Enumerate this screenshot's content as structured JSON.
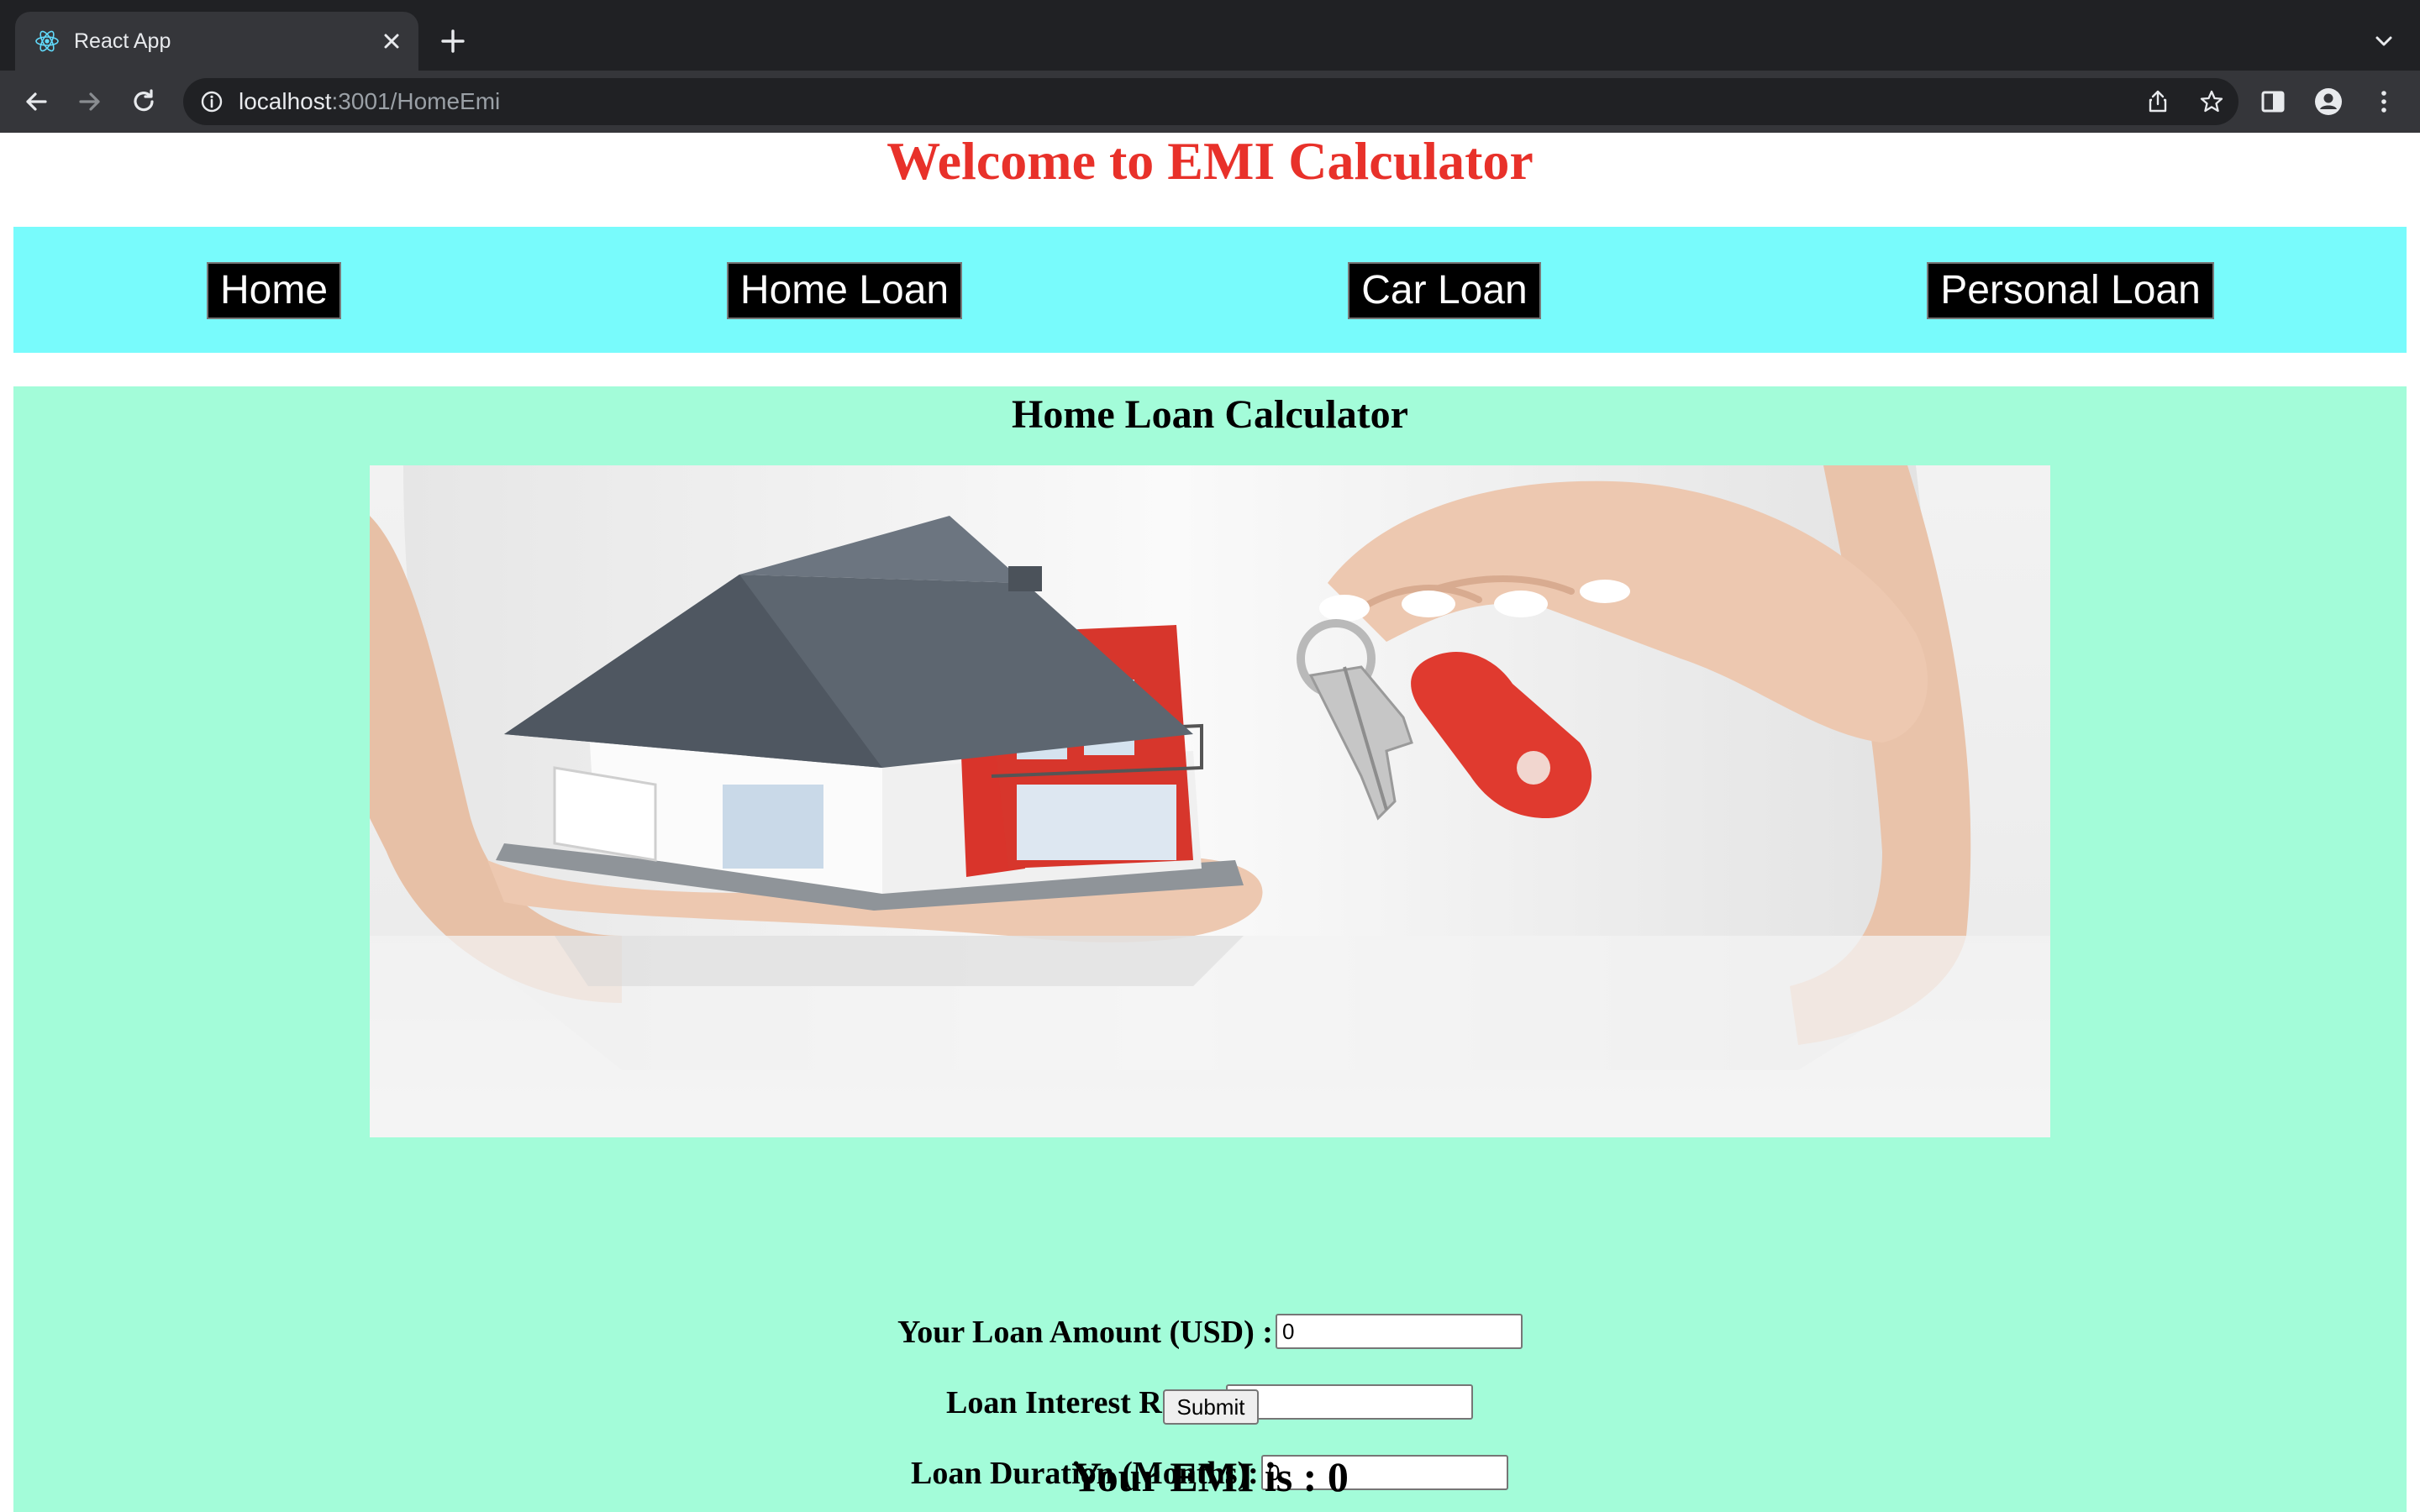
{
  "browser": {
    "tab_title": "React App",
    "url_host": "localhost",
    "url_rest": ":3001/HomeEmi"
  },
  "page": {
    "heading": "Welcome to EMI Calculator",
    "heading_color": "#e8312a",
    "nav": {
      "background": "#78fbfc",
      "items": [
        {
          "label": "Home"
        },
        {
          "label": "Home Loan"
        },
        {
          "label": "Car Loan"
        },
        {
          "label": "Personal Loan"
        }
      ]
    },
    "calculator": {
      "background": "#a3fcd9",
      "title": "Home Loan Calculator",
      "image": "hand holding model house and keys",
      "fields": {
        "amount": {
          "label": "Your Loan Amount (USD) :",
          "value": "0"
        },
        "rate": {
          "label": "Loan Interest Rate :",
          "value": "0"
        },
        "duration": {
          "label": "Loan Duration (Months):",
          "value": "0"
        }
      },
      "submit_label": "Submit",
      "result": "Your EMI is : 0"
    }
  }
}
